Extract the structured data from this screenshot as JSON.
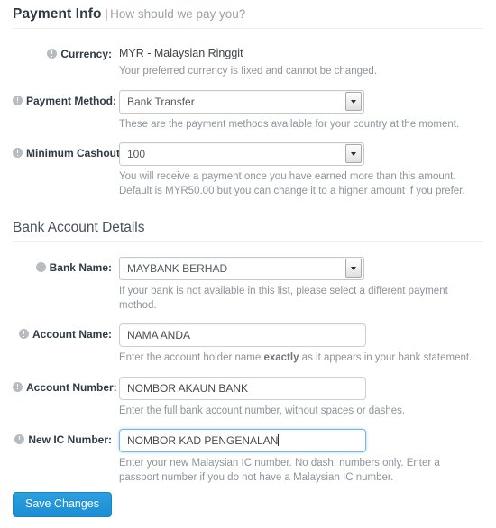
{
  "sections": {
    "payment_info": {
      "title": "Payment Info",
      "separator": "|",
      "subtitle": "How should we pay you?"
    },
    "bank_details": {
      "title": "Bank Account Details"
    }
  },
  "fields": {
    "currency": {
      "label": "Currency:",
      "value": "MYR - Malaysian Ringgit",
      "help": "Your preferred currency is fixed and cannot be changed."
    },
    "payment_method": {
      "label": "Payment Method:",
      "value": "Bank Transfer",
      "help": "These are the payment methods available for your country at the moment."
    },
    "minimum_cashout": {
      "label": "Minimum Cashout:",
      "value": "100",
      "help": "You will receive a payment once you have earned more than this amount. Default is MYR50.00 but you can change it to a higher amount if you prefer."
    },
    "bank_name": {
      "label": "Bank Name:",
      "value": "MAYBANK BERHAD",
      "help": "If your bank is not available in this list, please select a different payment method."
    },
    "account_name": {
      "label": "Account Name:",
      "value": "NAMA ANDA",
      "help_before": "Enter the account holder name ",
      "help_emphasis": "exactly",
      "help_after": " as it appears in your bank statement."
    },
    "account_number": {
      "label": "Account Number:",
      "value": "NOMBOR AKAUN BANK",
      "help": "Enter the full bank account number, without spaces or dashes."
    },
    "new_ic_number": {
      "label": "New IC Number:",
      "value": "NOMBOR KAD PENGENALAN",
      "help": "Enter your new Malaysian IC number. No dash, numbers only. Enter a passport number if you do not have a Malaysian IC number."
    }
  },
  "actions": {
    "save": "Save Changes"
  },
  "colors": {
    "primary": "#2490d8",
    "focus_border": "#79b7e3",
    "help_text": "#8d949b",
    "label_text": "#2f3a44"
  }
}
